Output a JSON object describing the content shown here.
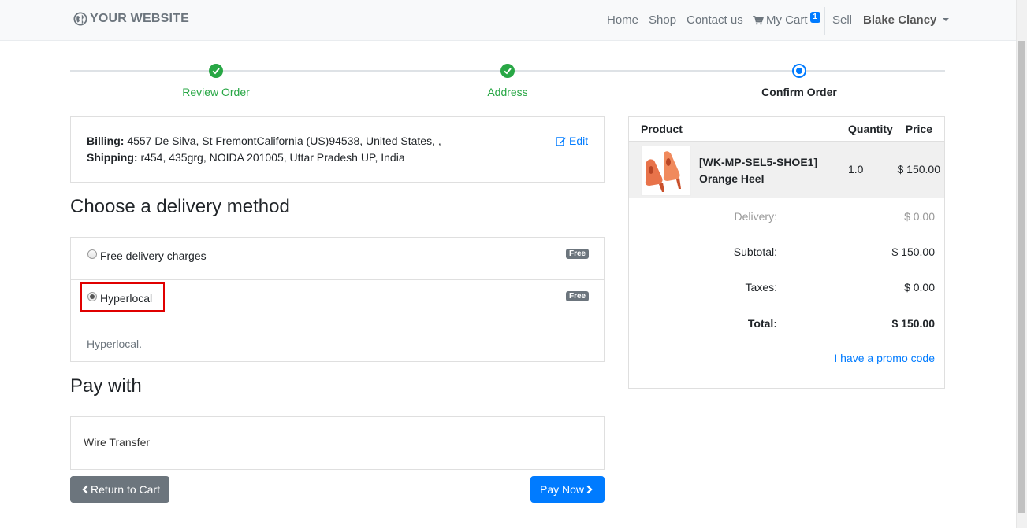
{
  "navbar": {
    "brand": "YOUR WEBSITE",
    "links": [
      "Home",
      "Shop",
      "Contact us"
    ],
    "cart_label": "My Cart",
    "cart_count": "1",
    "sell": "Sell",
    "user": "Blake Clancy"
  },
  "wizard": {
    "steps": [
      {
        "label": "Review Order",
        "state": "done"
      },
      {
        "label": "Address",
        "state": "done"
      },
      {
        "label": "Confirm Order",
        "state": "current"
      }
    ]
  },
  "address": {
    "billing_label": "Billing:",
    "billing": "4557 De Silva, St FremontCalifornia (US)94538, United States, ,",
    "shipping_label": "Shipping:",
    "shipping": "r454, 435grg, NOIDA 201005, Uttar Pradesh UP, India",
    "edit": "Edit"
  },
  "delivery": {
    "title": "Choose a delivery method",
    "options": [
      {
        "label": "Free delivery charges",
        "badge": "Free",
        "selected": false
      },
      {
        "label": "Hyperlocal",
        "badge": "Free",
        "selected": true
      }
    ],
    "description": "Hyperlocal."
  },
  "payment": {
    "title": "Pay with",
    "method": "Wire Transfer"
  },
  "buttons": {
    "return": "Return to Cart",
    "pay": "Pay Now"
  },
  "summary": {
    "headers": {
      "product": "Product",
      "quantity": "Quantity",
      "price": "Price"
    },
    "item": {
      "code": "[WK-MP-SEL5-SHOE1]",
      "name": "Orange Heel",
      "qty": "1.0",
      "price": "$ 150.00"
    },
    "delivery_label": "Delivery:",
    "delivery_value": "$ 0.00",
    "subtotal_label": "Subtotal:",
    "subtotal_value": "$ 150.00",
    "taxes_label": "Taxes:",
    "taxes_value": "$ 0.00",
    "total_label": "Total:",
    "total_value": "$ 150.00",
    "promo": "I have a promo code"
  },
  "colors": {
    "accent": "#007bff",
    "success": "#28a745",
    "secondary": "#6c757d",
    "highlight": "#e00000"
  }
}
